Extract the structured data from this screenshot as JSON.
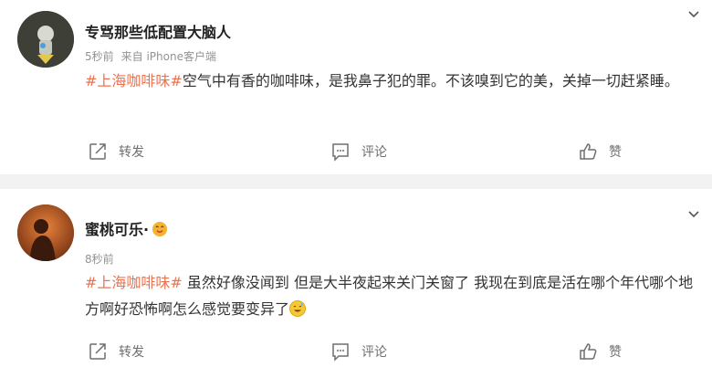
{
  "posts": [
    {
      "username": "专骂那些低配置大脑人",
      "time": "5秒前",
      "source": "来自 iPhone客户端",
      "hashtag": "#上海咖啡味#",
      "text": "空气中有香的咖啡味，是我鼻子犯的罪。不该嗅到它的美，关掉一切赶紧睡。",
      "actions": {
        "forward": "转发",
        "comment": "评论",
        "like": "赞"
      }
    },
    {
      "username": "蜜桃可乐·",
      "time": "8秒前",
      "hashtag": "#上海咖啡味#",
      "text": " 虽然好像没闻到 但是大半夜起来关门关窗了 我现在到底是活在哪个年代哪个地方啊好恐怖啊怎么感觉要变异了",
      "actions": {
        "forward": "转发",
        "comment": "评论",
        "like": "赞"
      }
    }
  ],
  "colors": {
    "hashtag": "#eb7350",
    "meta": "#939393",
    "action": "#6f6f6f"
  },
  "icons": [
    "chevron-down-icon",
    "forward-icon",
    "comment-icon",
    "like-icon",
    "emoji-icon",
    "verified-badge-icon"
  ]
}
